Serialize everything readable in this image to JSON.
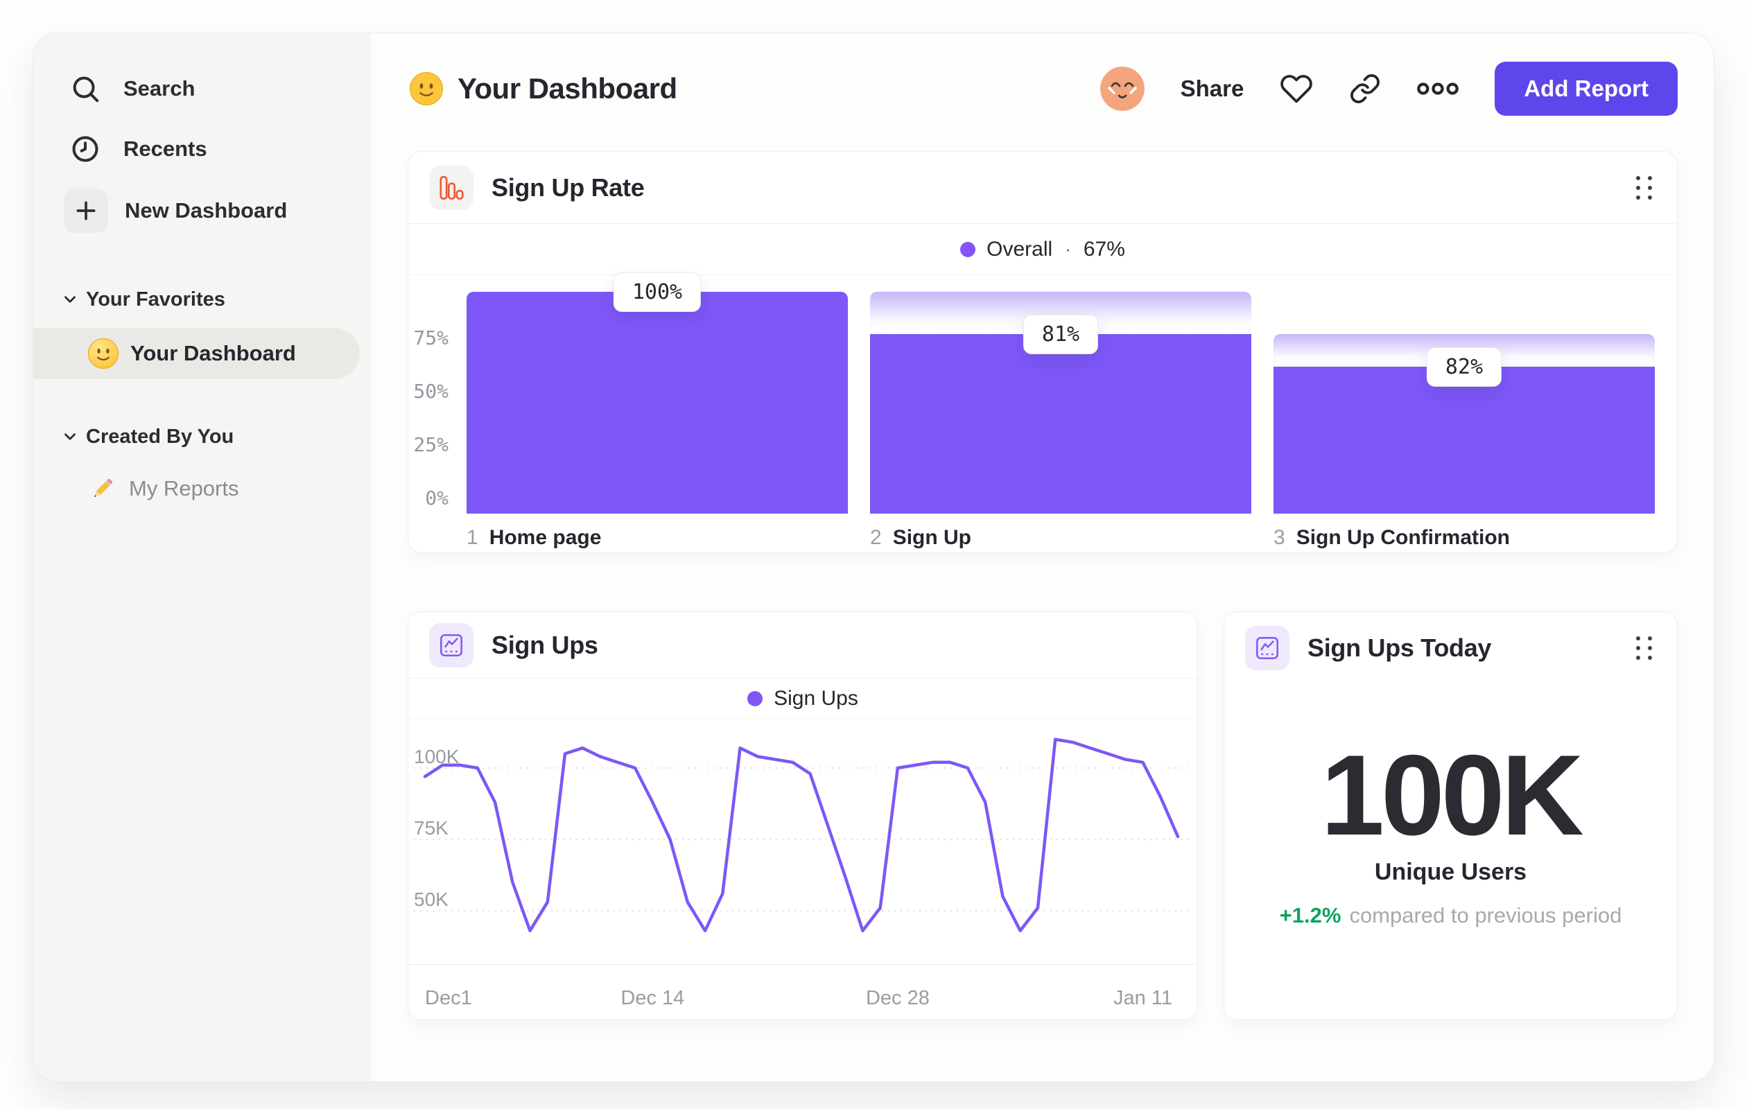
{
  "sidebar": {
    "nav": [
      {
        "label": "Search",
        "icon": "search-icon"
      },
      {
        "label": "Recents",
        "icon": "clock-icon"
      },
      {
        "label": "New Dashboard",
        "icon": "plus-icon"
      }
    ],
    "sections": [
      {
        "label": "Your Favorites",
        "icon": "chevron-down-icon",
        "items": [
          {
            "label": "Your Dashboard",
            "icon": "smiley-emoji-icon",
            "selected": true
          }
        ]
      },
      {
        "label": "Created By You",
        "icon": "chevron-down-icon",
        "items": [
          {
            "label": "My Reports",
            "icon": "pencil-emoji-icon",
            "selected": false
          }
        ]
      }
    ]
  },
  "header": {
    "emoji_icon": "smiley-emoji-icon",
    "title": "Your Dashboard",
    "share_label": "Share",
    "add_report_label": "Add Report",
    "icons": [
      "avatar",
      "heart-icon",
      "link-icon",
      "more-options-icon"
    ]
  },
  "colors": {
    "accent_purple": "#7e57f8",
    "button_purple": "#5d46ec",
    "legend_dot_purple": "#8355f3",
    "funnel_icon_orange": "#ed5b3b",
    "positive_green": "#0ca35f",
    "funnel_gradient_top": "#c6b6f8"
  },
  "chart_data": [
    {
      "type": "bar",
      "subtype": "funnel",
      "title": "Sign Up Rate",
      "legend_label": "Overall",
      "legend_separator": "·",
      "legend_value": "67%",
      "ylim": [
        0,
        100
      ],
      "y_ticks": [
        {
          "label": "75%",
          "value": 75
        },
        {
          "label": "50%",
          "value": 50
        },
        {
          "label": "25%",
          "value": 25
        },
        {
          "label": "0%",
          "value": 0
        }
      ],
      "steps": [
        {
          "index": "1",
          "label": "Home page",
          "conversion_label": "100%",
          "conversion_from_previous_pct": 100,
          "overall_pct": 100
        },
        {
          "index": "2",
          "label": "Sign Up",
          "conversion_label": "81%",
          "conversion_from_previous_pct": 81,
          "overall_pct": 81
        },
        {
          "index": "3",
          "label": "Sign Up Confirmation",
          "conversion_label": "82%",
          "conversion_from_previous_pct": 82,
          "overall_pct": 66.4
        }
      ],
      "bar_color": "#7e57f8",
      "legend_position": "top-center"
    },
    {
      "type": "line",
      "title": "Sign Ups",
      "legend_label": "Sign Ups",
      "x_ticks": [
        {
          "label": "Dec1",
          "day": 0
        },
        {
          "label": "Dec 14",
          "day": 13
        },
        {
          "label": "Dec 28",
          "day": 27
        },
        {
          "label": "Jan 11",
          "day": 41
        }
      ],
      "y_ticks": [
        {
          "label": "100K",
          "value": 100
        },
        {
          "label": "75K",
          "value": 75
        },
        {
          "label": "50K",
          "value": 50
        }
      ],
      "unit": "thousands of sign ups per day",
      "ylim_thousands": [
        38,
        114
      ],
      "values_thousands": [
        97,
        101,
        101,
        100,
        88,
        60,
        43,
        53,
        105,
        107,
        104,
        102,
        100,
        88,
        75,
        53,
        43,
        56,
        107,
        104,
        103,
        102,
        98,
        80,
        62,
        43,
        51,
        100,
        101,
        102,
        102,
        100,
        88,
        55,
        43,
        51,
        110,
        109,
        107,
        105,
        103,
        102,
        90,
        76
      ],
      "line_color": "#7d57f7",
      "grid": "dashed horizontal gridlines at y ticks"
    },
    {
      "type": "stat",
      "title": "Sign Ups Today",
      "value": "100K",
      "value_label": "Unique Users",
      "delta": "+1.2%",
      "delta_note": "compared to previous period"
    }
  ]
}
